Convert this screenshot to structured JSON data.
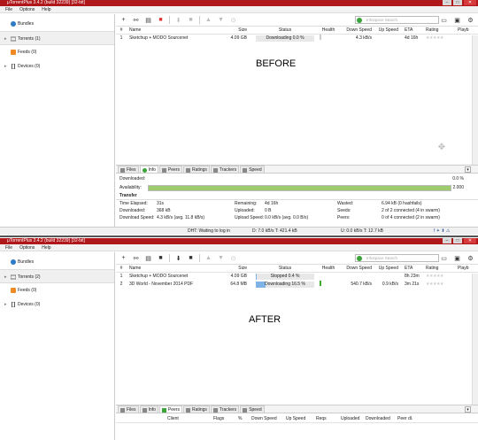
{
  "before": {
    "title": "µTorrentPlus 3.4.2  (build 32239) [32-bit]",
    "menu": [
      "File",
      "Options",
      "Help"
    ],
    "sidebar": [
      {
        "label": "Bundles",
        "icon": "bundle-icon"
      },
      {
        "label": "Torrents (1)",
        "icon": "torrent-icon"
      },
      {
        "label": "Feeds (0)",
        "icon": "rss-icon"
      },
      {
        "label": "Devices (0)",
        "icon": "device-icon"
      }
    ],
    "search_placeholder": "Infospace Search",
    "columns": [
      "#",
      "Name",
      "Size",
      "Status",
      "Health",
      "Down Speed",
      "Up Speed",
      "ETA",
      "Rating",
      "Playb"
    ],
    "rows": [
      {
        "num": "1",
        "name": "Sketchup + MODO Sourcenet",
        "size": "4.09 GB",
        "status": "Downloading 0.0 %",
        "progress": 0.0,
        "down": "4.3 kB/s",
        "up": "",
        "eta": "4d 16h"
      }
    ],
    "overlay": "BEFORE",
    "tabs": [
      "Files",
      "Info",
      "Peers",
      "Ratings",
      "Trackers",
      "Speed"
    ],
    "active_tab": "Info",
    "downloaded_label": "Downloaded:",
    "downloaded_value": "0.0 %",
    "availability_label": "Availability:",
    "availability_value": "2.000",
    "availability_fraction": 1.0,
    "transfer_title": "Transfer",
    "transfer": [
      [
        "Time Elapsed:",
        "31s",
        "Remaining:",
        "4d 16h",
        "Wasted:",
        "6.94 kB (0 hashfails)"
      ],
      [
        "Downloaded:",
        "368 kB",
        "Uploaded:",
        "0 B",
        "Seeds:",
        "2 of 2 connected (4 in swarm)"
      ],
      [
        "Download Speed:",
        "4.3 kB/s (avg. 11.8 kB/s)",
        "Upload Speed:",
        "0.0 kB/s (avg. 0.0 B/s)",
        "Peers:",
        "0 of 4 connected (2 in swarm)"
      ]
    ],
    "status_dht": "DHT: Waiting to log in",
    "status_d": "D: 7.0 kB/s T: 421.4 kB",
    "status_u": "U: 0.0 kB/s T: 12.7 kB"
  },
  "after": {
    "title": "µTorrentPlus 3.4.2  (build 32239) [32-bit]",
    "menu": [
      "File",
      "Options",
      "Help"
    ],
    "sidebar": [
      {
        "label": "Bundles",
        "icon": "bundle-icon"
      },
      {
        "label": "Torrents (2)",
        "icon": "torrent-icon"
      },
      {
        "label": "Feeds (0)",
        "icon": "rss-icon"
      },
      {
        "label": "Devices (0)",
        "icon": "device-icon"
      }
    ],
    "search_placeholder": "Infospace Search",
    "columns": [
      "#",
      "Name",
      "Size",
      "Status",
      "Health",
      "Down Speed",
      "Up Speed",
      "ETA",
      "Rating",
      "Playb"
    ],
    "rows": [
      {
        "num": "1",
        "name": "Sketchup + MODO Sourcenet",
        "size": "4.09 GB",
        "status": "Stopped 0.4 %",
        "progress": 0.004,
        "down": "",
        "up": "",
        "eta": "8h 23m"
      },
      {
        "num": "2",
        "name": "3D World - November 2014 PDF",
        "size": "64.8 MB",
        "status": "Downloading 16.5 %",
        "progress": 0.165,
        "down": "540.7 kB/s",
        "up": "0.9 kB/s",
        "eta": "3m 21s"
      }
    ],
    "overlay": "AFTER",
    "tabs": [
      "Files",
      "Info",
      "Peers",
      "Ratings",
      "Trackers",
      "Speed"
    ],
    "active_tab": "Peers",
    "peer_columns": [
      "Client",
      "Flags",
      "%",
      "Down Speed",
      "Up Speed",
      "Reqs",
      "Uploaded",
      "Downloaded",
      "Peer dl."
    ]
  },
  "colors": {
    "titlebar": "#b0171b",
    "progress_blue": "#7fb2e5",
    "availability_green": "#9ccc6e",
    "health_green": "#3fae2a"
  }
}
